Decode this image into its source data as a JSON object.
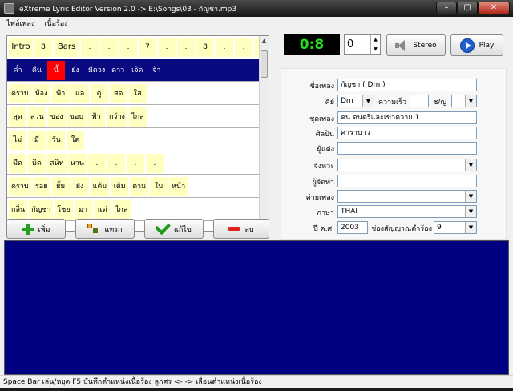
{
  "window": {
    "title": "eXtreme Lyric Editor Version 2.0   -> E:\\Songs\\03 - กัญชา.mp3",
    "minimize": "–",
    "maximize": "▢",
    "close": "✕"
  },
  "menu": [
    "ไฟล์เพลง",
    "เนื้อร้อง"
  ],
  "lyrics": {
    "rows": [
      [
        "Intro",
        "8",
        "Bars",
        ".",
        ".",
        ".",
        "7",
        ".",
        ".",
        "8",
        ".",
        ".",
        "."
      ],
      [
        "ค่ำ",
        "คืน",
        "นี้",
        "ยัง",
        "มีดวง",
        "ดาว",
        "เจิด",
        "จ้า"
      ],
      [
        "คราบ",
        "ห้อง",
        "ฟ้า",
        "แล",
        "ดู",
        "สด",
        "ใส"
      ],
      [
        "สุด",
        "ส่วน",
        "ของ",
        "ขอบ",
        "ฟ้า",
        "กว้าง",
        "ไกล"
      ],
      [
        "ไม่",
        "มี",
        "วัน",
        "ใด"
      ],
      [
        "มืด",
        "มิด",
        "สนิท",
        "นาน",
        ".",
        ".",
        ".",
        "."
      ],
      [
        "คราบ",
        "รอย",
        "ยิ้ม",
        "ยัง",
        "แต้ม",
        "เติม",
        "ตาม",
        "ใบ",
        "หน้า"
      ],
      [
        "กลิ่น",
        "กัญชา",
        "โชย",
        "มา",
        "แต่",
        "ไกล"
      ]
    ],
    "active_row": 1,
    "current_word": 2
  },
  "buttons": {
    "add": "เพิ่ม",
    "insert": "แทรก",
    "edit": "แก้ไข",
    "delete": "ลบ",
    "stereo": "Stereo",
    "play": "Play"
  },
  "timer": "0:8",
  "spin_value": "0",
  "info": {
    "song_name_label": "ชื่อเพลง",
    "song_name": "กัญชา ( Dm )",
    "key_label": "คีย์",
    "key": "Dm",
    "tempo_label": "ความเร็ว",
    "tempo": "",
    "gender_label": "ช/ญ",
    "gender": "",
    "album_label": "ชุดเพลง",
    "album": "คน ดนตรีและเขาควาย 1",
    "artist_label": "ศิลปิน",
    "artist": "คาราบาว",
    "composer_label": "ผู้แต่ง",
    "composer": "",
    "rhythm_label": "จังหวะ",
    "rhythm": "",
    "producer_label": "ผู้จัดทำ",
    "producer": "",
    "label_label": "ค่ายเพลง",
    "label": "",
    "language_label": "ภาษา",
    "language": "THAI",
    "year_label": "ปี ค.ศ.",
    "year": "2003",
    "lyric_signal_label": "ช่องสัญญาณคำร้อง",
    "lyric_signal": "9"
  },
  "status": "Space Bar เล่น/หยุด  F5 บันทึกตำแหน่งเนื้อร้อง   ลูกศร  <-  ->  เลื่อนตำแหน่งเนื้อร้อง"
}
